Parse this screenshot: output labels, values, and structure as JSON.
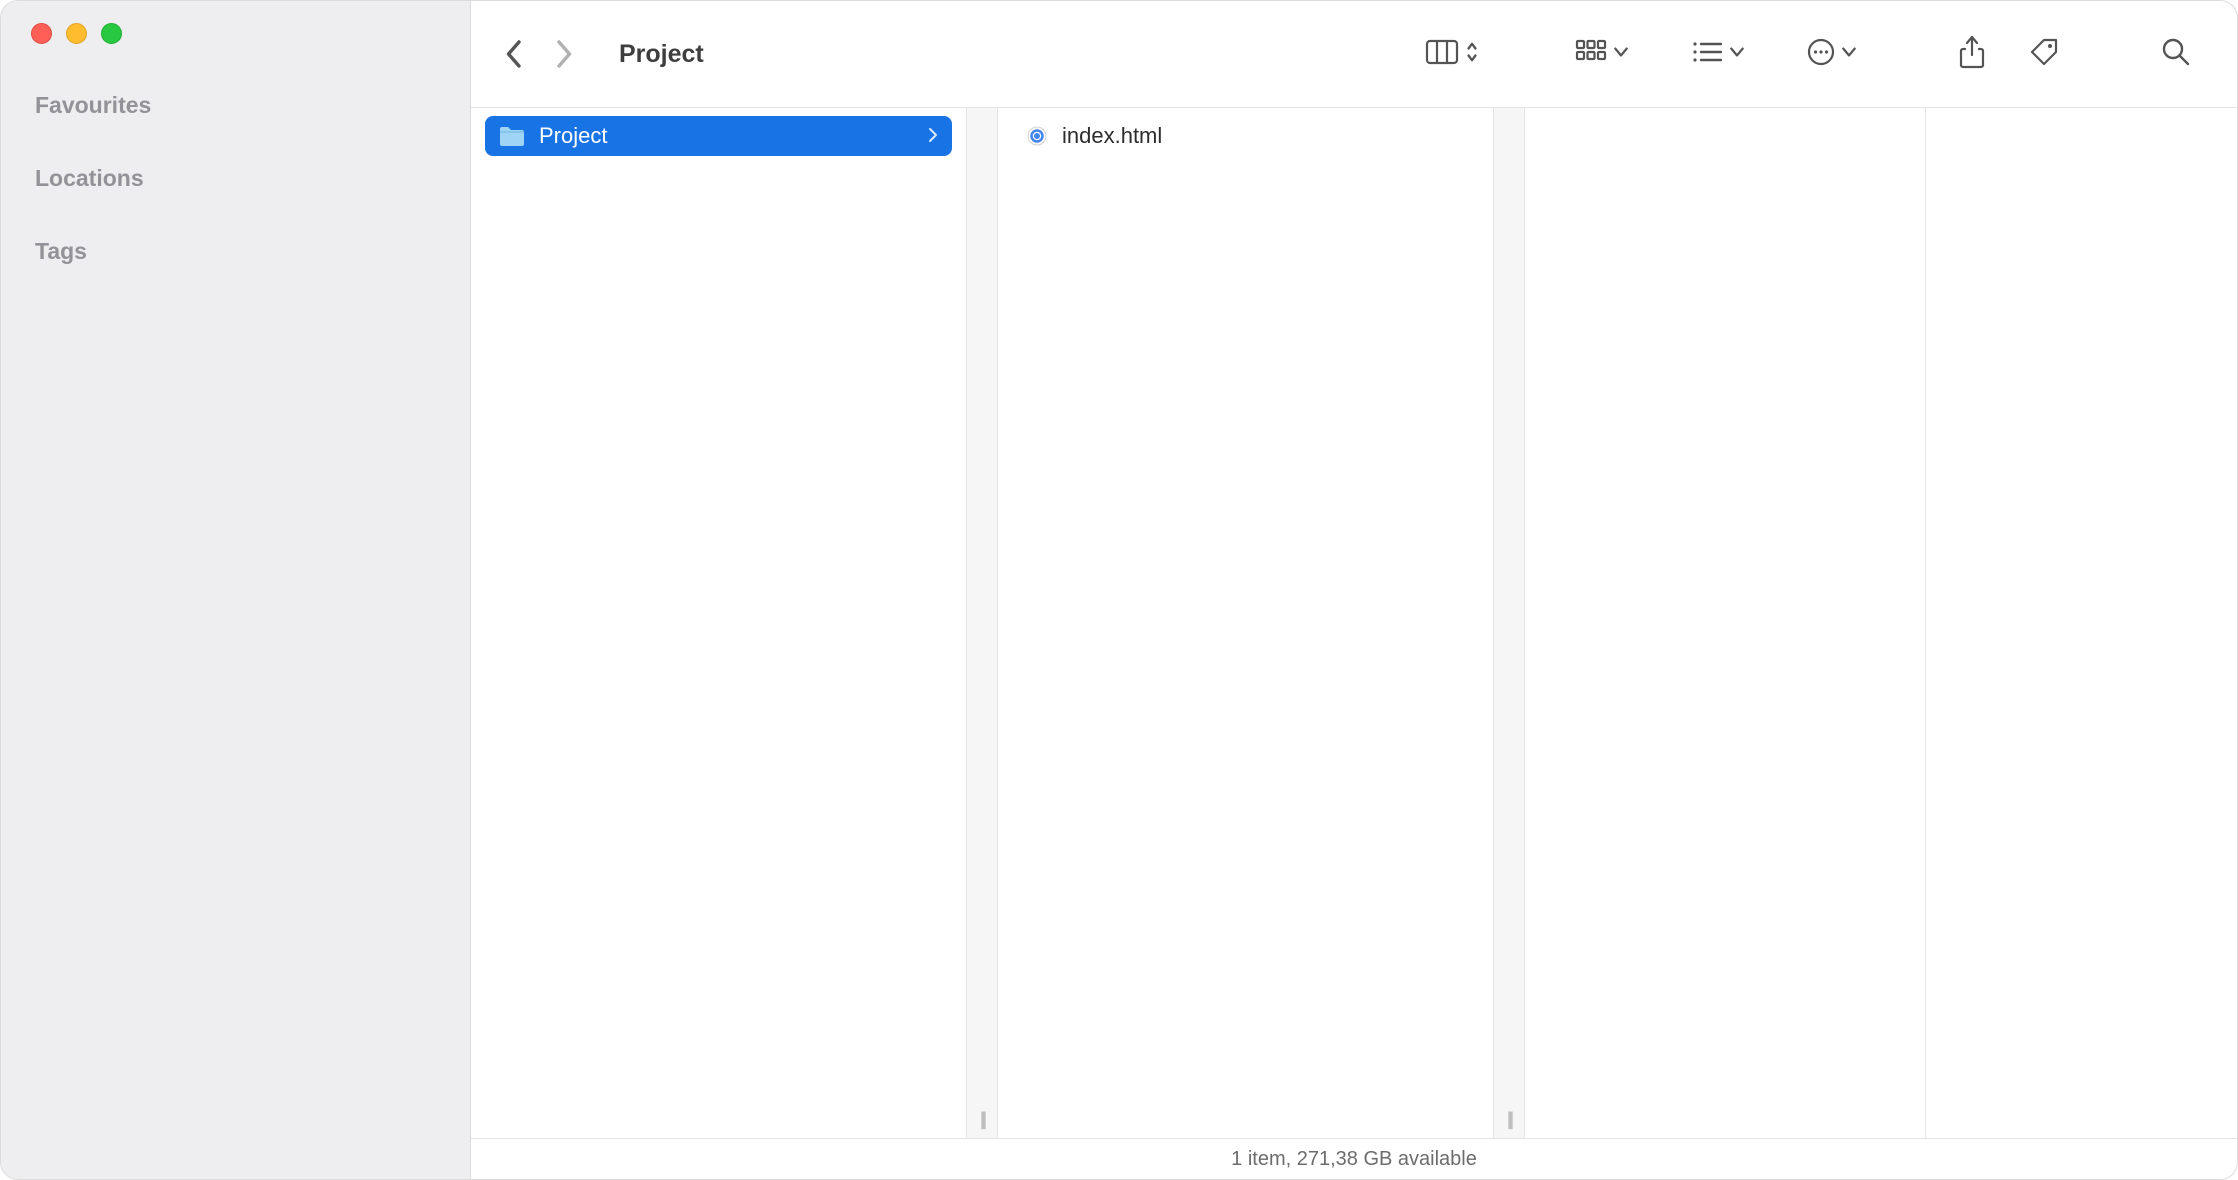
{
  "title": "Project",
  "sidebar": {
    "headings": [
      "Favourites",
      "Locations",
      "Tags"
    ]
  },
  "columns": {
    "col1": {
      "folder": "Project"
    },
    "col2": {
      "file": "index.html"
    }
  },
  "status": "1 item, 271,38 GB available"
}
